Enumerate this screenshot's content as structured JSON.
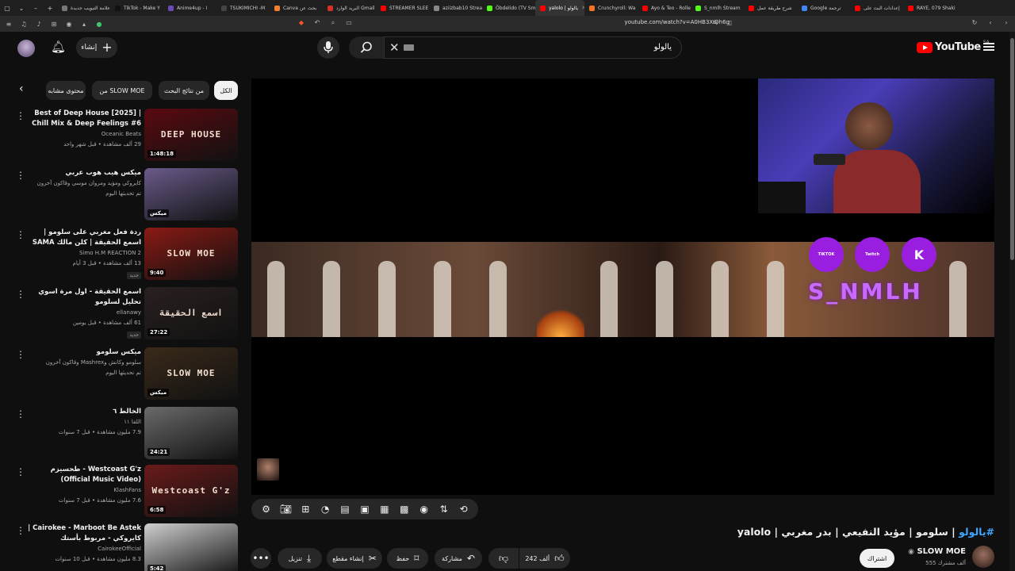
{
  "browser": {
    "tabs": [
      {
        "label": "علامة التبويب جديدة",
        "color": "#777777"
      },
      {
        "label": "TikTok - Make Y",
        "color": "#111111"
      },
      {
        "label": "Anime4up - ا",
        "color": "#6a4ab8"
      },
      {
        "label": "TSUKIMICHI -M",
        "color": "#444444"
      },
      {
        "label": "Canva بحث عن",
        "color": "#f08030"
      },
      {
        "label": "البريد الوارد Gmail",
        "color": "#d93025"
      },
      {
        "label": "STREAMER SLEE",
        "color": "#ff0000"
      },
      {
        "label": "aziizbab10 Strea",
        "color": "#888888"
      },
      {
        "label": "Öbdelido (TV Sm",
        "color": "#53fc18"
      },
      {
        "label": "yalolo | يالولو",
        "color": "#ff0000",
        "active": true
      },
      {
        "label": "Crunchyroll: Wa",
        "color": "#f47521"
      },
      {
        "label": "Ayo & Teo - Rolle",
        "color": "#ff0000"
      },
      {
        "label": "S_nmlh Stream",
        "color": "#53fc18"
      },
      {
        "label": "شرح طريقة عمل",
        "color": "#ff0000"
      },
      {
        "label": "Google ترجمة",
        "color": "#4285f4"
      },
      {
        "label": "إعدادات البث على",
        "color": "#ff0000"
      },
      {
        "label": "RAYE, 079 Shaki",
        "color": "#ff0000"
      }
    ],
    "url": "youtube.com/watch?v=A0HB3XIDh6g"
  },
  "header": {
    "create_label": "إنشاء",
    "search_query": "يالولو",
    "logo_text": "YouTube",
    "country_code": "SA"
  },
  "chips": {
    "all": "الكل",
    "from_search": "من نتائج البحث",
    "from_channel": "من SLOW MOE",
    "related": "محتوى مشابه"
  },
  "recommendations": [
    {
      "title": "Best of Deep House [2025] | Chill Mix & Deep Feelings #6",
      "channel": "Oceanic Beats",
      "stats": "29 ألف مشاهدة • قبل شهر واحد",
      "duration": "1:48:18",
      "thumb_text": "DEEP HOUSE",
      "thumb_color": "#5a0a10",
      "badge": ""
    },
    {
      "title": "ميكس هيب هوب عربي",
      "channel": "كايروكي ومؤيد ومروان موسى وقاكون آخرون",
      "stats": "تم تحديثها اليوم",
      "duration": "ميكس",
      "thumb_text": "",
      "thumb_color": "#6a5a8a",
      "badge": ""
    },
    {
      "title": "ردة فعل مغربي على سلومو | اسمع الحقيقة | كلن مالك SAMA",
      "channel": "Simo H.M REACTION 2",
      "stats": "13 ألف مشاهدة • قبل 3 أيام",
      "duration": "9:40",
      "thumb_text": "SLOW MOE",
      "thumb_color": "#8a1a14",
      "badge": "جديد"
    },
    {
      "title": "اسمع الحقيقة - اول مرة اسوي تحليل لسلومو",
      "channel": "ellanawy",
      "stats": "61 ألف مشاهدة • قبل يومين",
      "duration": "27:22",
      "thumb_text": "اسمع الحقيقة",
      "thumb_color": "#2a2020",
      "badge": "جديد"
    },
    {
      "title": "ميكس سلومو",
      "channel": "سلومو وكانش وMashrex وقاكون آخرون",
      "stats": "تم تحديثها اليوم",
      "duration": "ميكس",
      "thumb_text": "SLOW MOE",
      "thumb_color": "#3a2a1a",
      "badge": ""
    },
    {
      "title": "الخالط ٦",
      "channel": "اللقا ١١",
      "stats": "7.9 مليون مشاهدة • قبل 7 سنوات",
      "duration": "24:21",
      "thumb_text": "",
      "thumb_color": "#6a6a6a",
      "badge": ""
    },
    {
      "title": "Westcoast G'z - طحسيزم (Official Music Video)",
      "channel": "KlashFans",
      "stats": "7.6 مليون مشاهدة • قبل 7 سنوات",
      "duration": "6:58",
      "thumb_text": "Westcoast G'z",
      "thumb_color": "#6a1a1a",
      "badge": ""
    },
    {
      "title": "Cairokee - Marboot Be Astek | كايروكي - مربوط بأستك",
      "channel": "CairokeeOfficial",
      "stats": "8.3 مليون مشاهدة • قبل 10 سنوات",
      "duration": "5:42",
      "thumb_text": "",
      "thumb_color": "#cfcfcf",
      "badge": ""
    }
  ],
  "player": {
    "overlay_text": "S_NMLH",
    "social_labels": [
      "TIKTOK",
      "Twitch",
      "K"
    ]
  },
  "video": {
    "hashtag": "#يالولو",
    "title_rest": " | سلومو | مؤيد النفيعي | بدر مغربي | yalolo"
  },
  "actions": {
    "likes": "242 ألف",
    "share": "مشاركة",
    "save": "حفظ",
    "clip": "إنشاء مقطع",
    "download": "تنزيل"
  },
  "channel": {
    "name": "SLOW MOE",
    "subscribers": "555 ألف مشترك",
    "subscribe_label": "اشتراك"
  }
}
